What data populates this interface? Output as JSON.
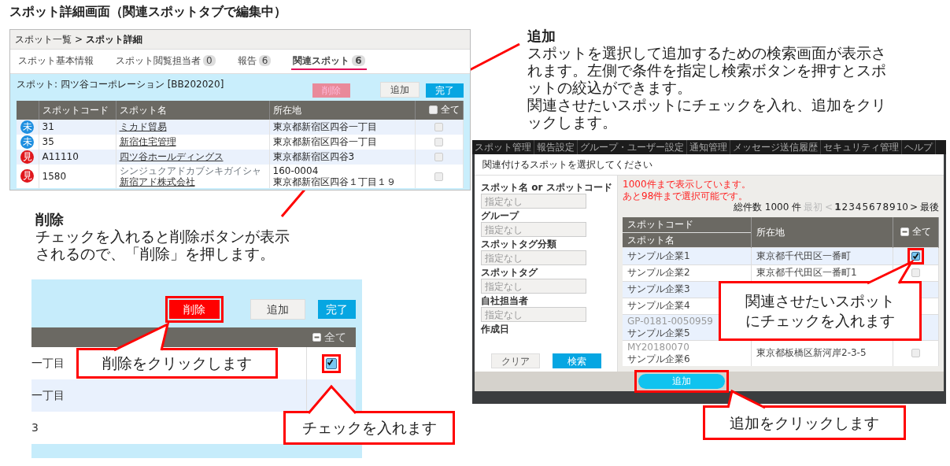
{
  "title": "スポット詳細画面（関連スポットタブで編集中）",
  "detail_screen": {
    "breadcrumb": {
      "parent": "スポット一覧",
      "separator": ">",
      "current": "スポット詳細"
    },
    "tabs": [
      {
        "label": "スポット基本情報",
        "selected": false
      },
      {
        "label": "スポット閲覧担当者",
        "count": "0",
        "selected": false
      },
      {
        "label": "報告",
        "count": "6",
        "selected": false
      },
      {
        "label": "関連スポット",
        "count": "6",
        "selected": true
      }
    ],
    "spot_label": "スポット: 四ツ谷コーポレーション [BB202020]",
    "buttons": [
      {
        "label": "削除",
        "kind": "delete",
        "disabled": true
      },
      {
        "label": "追加",
        "kind": "add",
        "disabled": false
      },
      {
        "label": "完了",
        "kind": "done",
        "disabled": false
      }
    ],
    "columns": [
      "スポットコード",
      "スポット名",
      "所在地"
    ],
    "select_all": "全て",
    "rows": [
      {
        "marker": "未",
        "color": "#1e8fe0",
        "code": "31",
        "name": "ミカド貿易",
        "address": "東京都新宿区四谷一丁目",
        "checked": false
      },
      {
        "marker": "未",
        "color": "#1e8fe0",
        "code": "35",
        "name": "新宿住宅管理",
        "address": "東京都新宿区四谷一丁目",
        "checked": false
      },
      {
        "marker": "見",
        "color": "#e0161c",
        "code": "A11110",
        "name": "四ツ谷ホールディングス",
        "address": "東京都新宿区四谷3",
        "checked": false
      },
      {
        "marker": "見",
        "color": "#e0161c",
        "code": "1580",
        "kana": "シンジュクアドカブシキガイシャ",
        "name": "新宿アド株式会社",
        "postal": "160-0004",
        "address": "東京都新宿区四谷１丁目１９",
        "checked": false
      }
    ]
  },
  "delete_note": {
    "heading": "削除",
    "text": "チェックを入れると削除ボタンが表示されるので、「削除」を押します。"
  },
  "zoom_view": {
    "buttons": [
      {
        "label": "削除",
        "kind": "delete",
        "disabled": false,
        "highlighted": true
      },
      {
        "label": "追加",
        "kind": "add",
        "disabled": false
      },
      {
        "label": "完了",
        "kind": "done",
        "disabled": false
      }
    ],
    "select_all": "全て",
    "rows": [
      {
        "address": "一丁目",
        "checked": true,
        "highlighted": true
      },
      {
        "address": "一丁目"
      },
      {
        "address": "3"
      }
    ],
    "callouts": [
      "削除をクリックします",
      "チェックを入れます"
    ]
  },
  "add_note": {
    "heading": "追加",
    "paragraphs": [
      "スポットを選択して追加するための検索画面が表示されます。左側で条件を指定し検索ボタンを押すとスポットの絞込ができます。",
      "関連させたいスポットにチェックを入れ、追加をクリックします。"
    ]
  },
  "dialog": {
    "menu": [
      "スポット管理",
      "報告設定",
      "グループ・ユーザー設定",
      "通知管理",
      "メッセージ送信履歴",
      "セキュリティ管理",
      "ヘルプ"
    ],
    "title": "関連付けるスポットを選択してください",
    "filters": [
      {
        "label": "スポット名 or スポットコード",
        "placeholder": "指定なし"
      },
      {
        "label": "グループ",
        "placeholder": "指定なし"
      },
      {
        "label": "スポットタグ分類",
        "placeholder": "指定なし"
      },
      {
        "label": "スポットタグ",
        "placeholder": "指定なし"
      },
      {
        "label": "自社担当者",
        "placeholder": "指定なし"
      }
    ],
    "partial_label": "作成日",
    "filter_buttons": [
      {
        "label": "クリア",
        "kind": "clear"
      },
      {
        "label": "検索",
        "kind": "search"
      }
    ],
    "notices": [
      "1000件まで表示しています。",
      "あと98件まで選択可能です。"
    ],
    "total": "総件数 1000 件",
    "pagination": {
      "first": {
        "label": "最初",
        "disabled": true
      },
      "prev": {
        "label": "<",
        "disabled": true
      },
      "pages": [
        {
          "label": "1",
          "selected": true
        },
        {
          "label": "2",
          "selected": false
        },
        {
          "label": "3",
          "selected": false
        },
        {
          "label": "4",
          "selected": false
        },
        {
          "label": "5",
          "selected": false
        },
        {
          "label": "6",
          "selected": false
        },
        {
          "label": "7",
          "selected": false
        },
        {
          "label": "8",
          "selected": false
        },
        {
          "label": "9",
          "selected": false
        },
        {
          "label": "10",
          "selected": false
        }
      ],
      "next": {
        "label": ">",
        "disabled": false
      },
      "last": {
        "label": "最後",
        "disabled": false
      }
    },
    "columns": {
      "code": "スポットコード",
      "name": "スポット名",
      "address": "所在地",
      "select_all": "全て"
    },
    "rows": [
      {
        "name": "サンプル企業1",
        "address": "東京都千代田区一番町",
        "checked": true,
        "highlighted": true
      },
      {
        "name": "サンプル企業2",
        "address": "東京都千代田区一番町1",
        "checked": false
      },
      {
        "name": "サンプル企業3"
      },
      {
        "name": "サンプル企業4"
      },
      {
        "code": "GP-0181-0050959",
        "name": "サンプル企業5"
      },
      {
        "code": "MY20180070",
        "name": "サンプル企業6",
        "address": "東京都板橋区新河岸2-3-5",
        "checked": false
      }
    ],
    "footer_button": {
      "label": "追加",
      "highlighted": true
    },
    "callouts": [
      "関連させたいスポットにチェックを入れます",
      "追加をクリックします"
    ]
  }
}
